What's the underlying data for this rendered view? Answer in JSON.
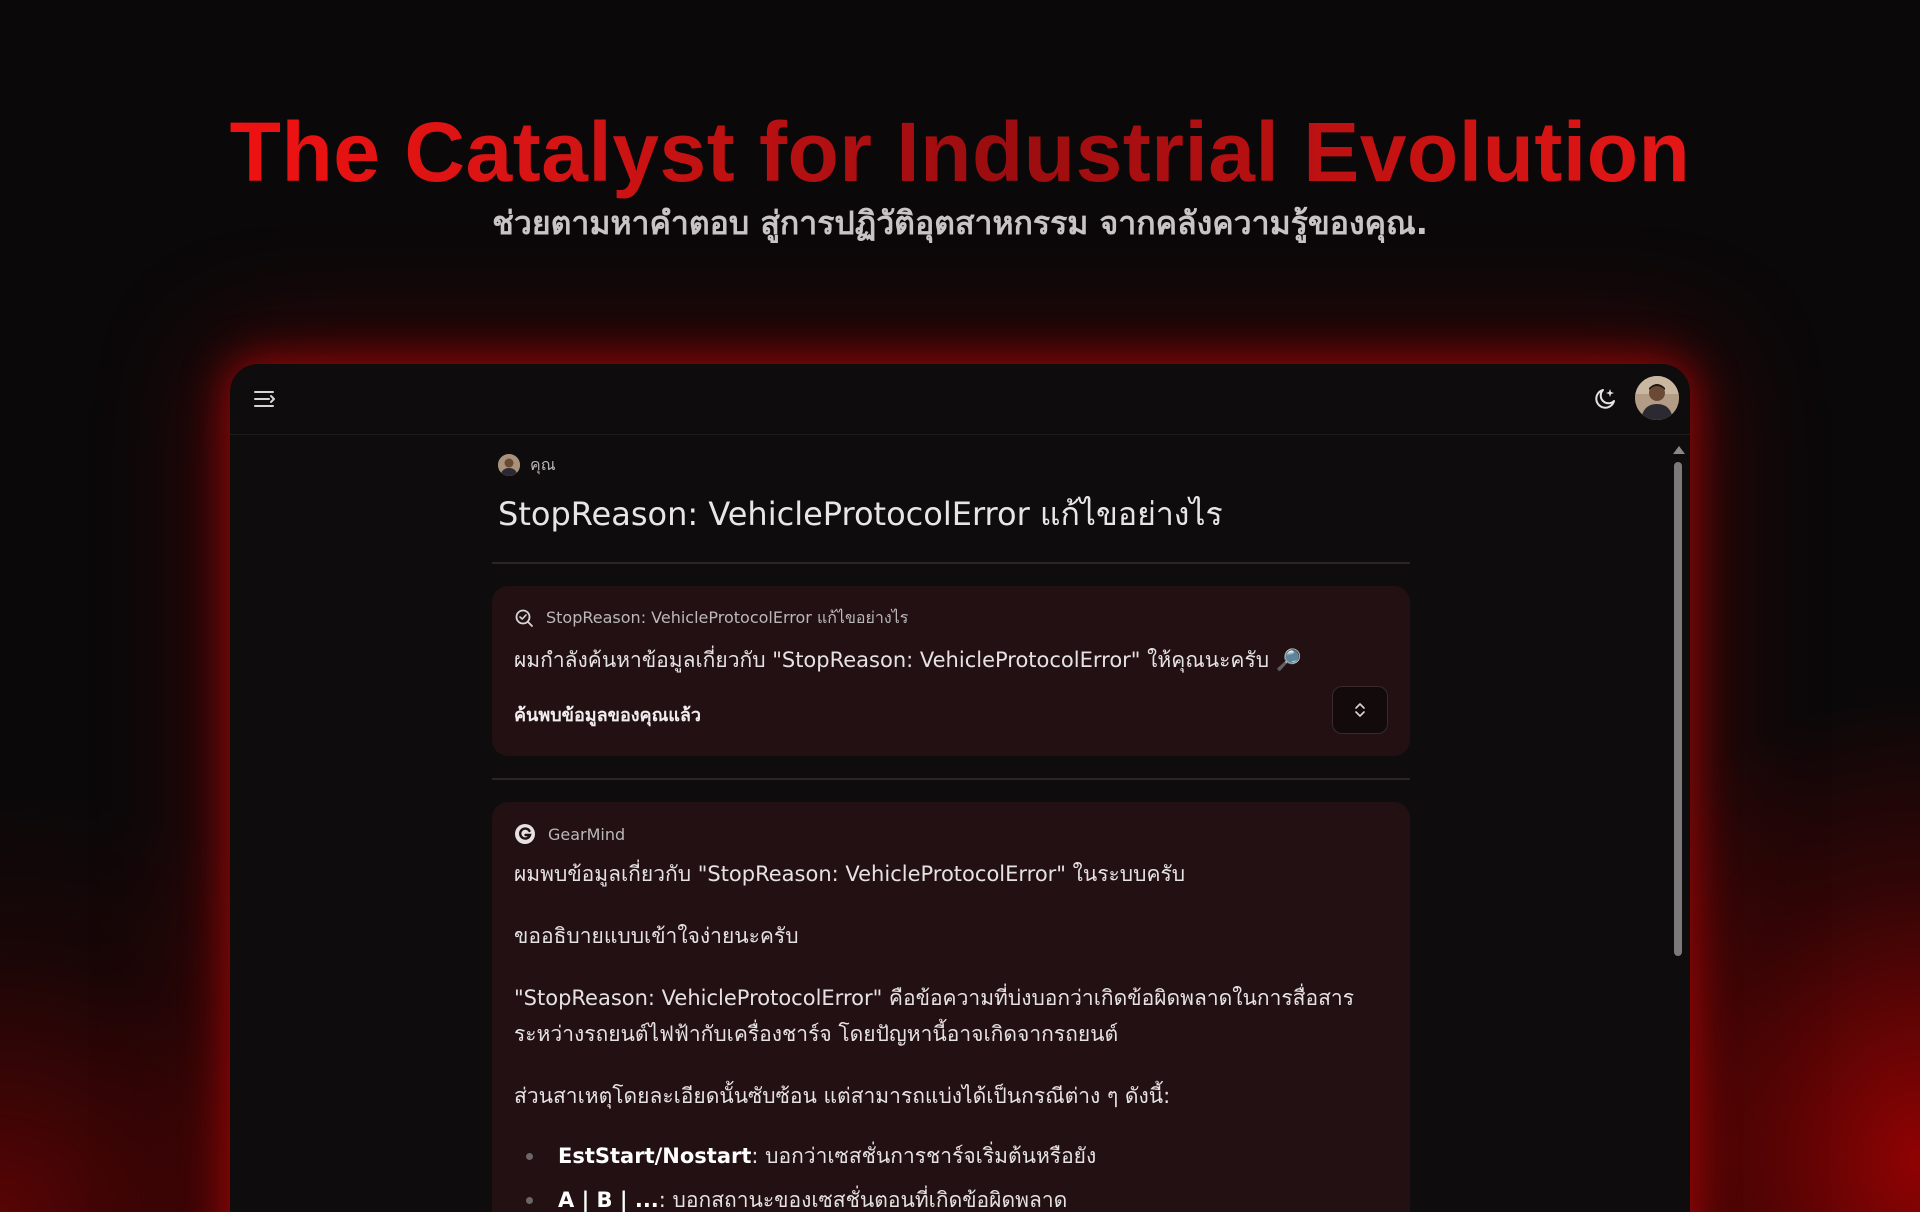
{
  "hero": {
    "title": "The Catalyst for Industrial Evolution",
    "subtitle": "ช่วยตามหาคำตอบ สู่การปฏิวัติอุตสาหกรรม จากคลังความรู้ของคุณ."
  },
  "topbar": {
    "menu_icon": "menu-icon",
    "theme_icon": "moon-star-icon",
    "avatar_icon": "user-avatar"
  },
  "user_message": {
    "author": "คุณ",
    "text": "StopReason: VehicleProtocolError แก้ไขอย่างไร"
  },
  "search_card": {
    "query": "StopReason: VehicleProtocolError แก้ไขอย่างไร",
    "status_text": "ผมกำลังค้นหาข้อมูลเกี่ยวกับ \"StopReason: VehicleProtocolError\" ให้คุณนะครับ 🔎",
    "found_label": "ค้นพบข้อมูลของคุณแล้ว",
    "icon": "search-icon",
    "expand_icon": "chevron-up-down-icon"
  },
  "answer_card": {
    "author": "GearMind",
    "icon": "gearmind-logo-icon",
    "paragraphs": [
      "ผมพบข้อมูลเกี่ยวกับ \"StopReason: VehicleProtocolError\" ในระบบครับ",
      "ขออธิบายแบบเข้าใจง่ายนะครับ",
      "\"StopReason: VehicleProtocolError\" คือข้อความที่บ่งบอกว่าเกิดข้อผิดพลาดในการสื่อสารระหว่างรถยนต์ไฟฟ้ากับเครื่องชาร์จ โดยปัญหานี้อาจเกิดจากรถยนต์",
      "ส่วนสาเหตุโดยละเอียดนั้นซับซ้อน แต่สามารถแบ่งได้เป็นกรณีต่าง ๆ ดังนี้:"
    ],
    "bullets": [
      {
        "term": "EstStart/Nostart",
        "desc": ": บอกว่าเซสชั่นการชาร์จเริ่มต้นหรือยัง"
      },
      {
        "term": "A | B | ...",
        "desc": ": บอกสถานะของเซสชั่นตอนที่เกิดข้อผิดพลาด"
      }
    ]
  },
  "colors": {
    "accent": "#e01212",
    "card_bg": "#221012",
    "window_bg": "#0e0c0d"
  }
}
